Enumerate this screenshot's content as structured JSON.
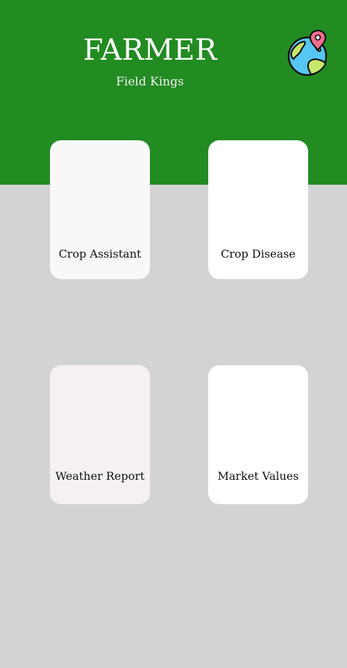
{
  "header": {
    "title": "FARMER",
    "subtitle": "Field Kings",
    "background_color": "#228b22",
    "location_icon": "globe-location-icon"
  },
  "cards": [
    {
      "label": "Crop Assistant",
      "background_color": "#f8f8f8"
    },
    {
      "label": "Crop Disease",
      "background_color": "#ffffff"
    },
    {
      "label": "Weather Report",
      "background_color": "#f5f1f0"
    },
    {
      "label": "Market Values",
      "background_color": "#ffffff"
    }
  ],
  "page": {
    "background_color": "#d3d3d3"
  }
}
